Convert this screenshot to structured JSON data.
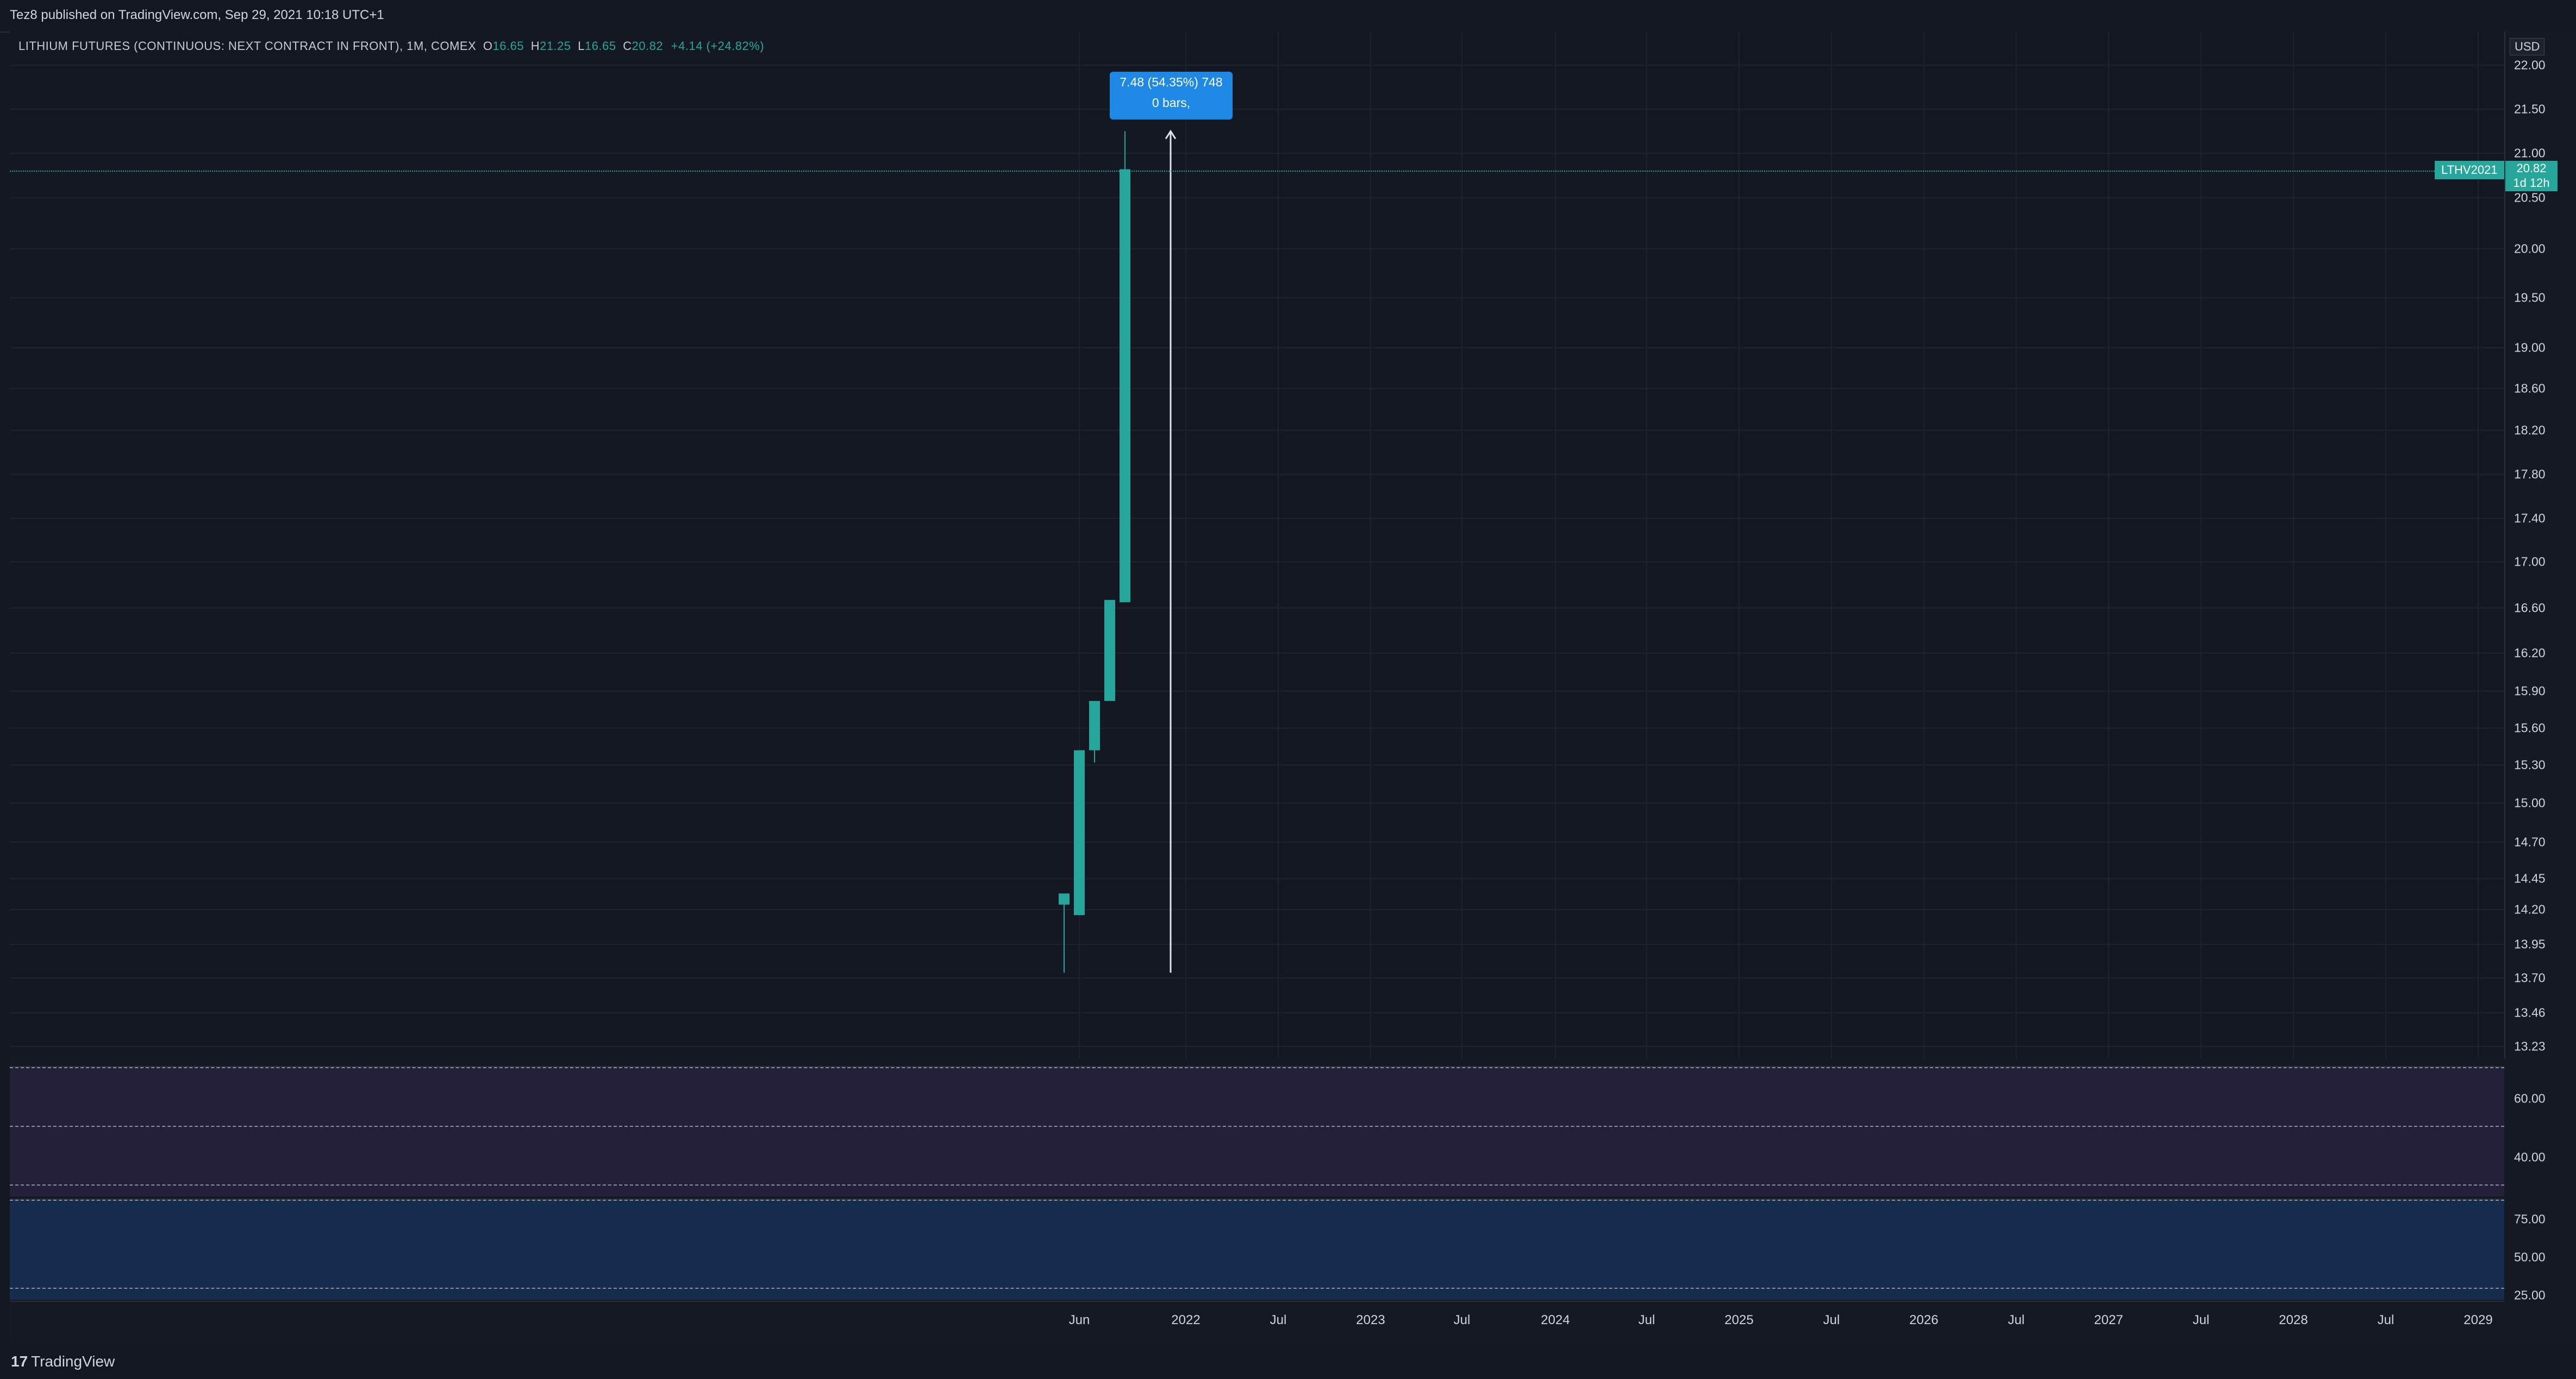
{
  "header": {
    "publisher_text": "Tez8 published on TradingView.com, Sep 29, 2021 10:18 UTC+1"
  },
  "legend": {
    "title": "LITHIUM FUTURES (CONTINUOUS: NEXT CONTRACT IN FRONT), 1M, COMEX",
    "o_label": "O",
    "o_value": "16.65",
    "h_label": "H",
    "h_value": "21.25",
    "l_label": "L",
    "l_value": "16.65",
    "c_label": "C",
    "c_value": "20.82",
    "change": "+4.14 (+24.82%)"
  },
  "price_axis": {
    "currency": "USD",
    "labels": [
      "22.00",
      "21.50",
      "21.00",
      "20.50",
      "20.00",
      "19.50",
      "19.00",
      "18.60",
      "18.20",
      "17.80",
      "17.40",
      "17.00",
      "16.60",
      "16.20",
      "15.90",
      "15.60",
      "15.30",
      "15.00",
      "14.70",
      "14.45",
      "14.20",
      "13.95",
      "13.70",
      "13.46",
      "13.23"
    ]
  },
  "price_marker": {
    "symbol": "LTHV2021",
    "price": "20.82",
    "countdown": "1d 12h"
  },
  "measure_tooltip": {
    "line1": "7.48 (54.35%) 748",
    "line2": "0 bars,"
  },
  "indicator1_axis": [
    "60.00",
    "40.00"
  ],
  "indicator2_axis": [
    "75.00",
    "50.00",
    "25.00"
  ],
  "time_axis": {
    "labels": [
      "Jun",
      "2022",
      "Jul",
      "2023",
      "Jul",
      "2024",
      "Jul",
      "2025",
      "Jul",
      "2026",
      "Jul",
      "2027",
      "Jul",
      "2028",
      "Jul",
      "2029"
    ]
  },
  "footer": {
    "brand_mark": "17",
    "brand_name": "TradingView"
  },
  "colors": {
    "up": "#26a69a",
    "background": "#131722",
    "tooltip": "#1e88e5"
  },
  "chart_data": {
    "type": "candlestick",
    "title": "LITHIUM FUTURES (CONTINUOUS: NEXT CONTRACT IN FRONT), 1M, COMEX",
    "candles": [
      {
        "open": 14.24,
        "high": 14.3,
        "low": 13.74,
        "close": 14.33
      },
      {
        "open": 14.16,
        "high": 15.42,
        "low": 14.16,
        "close": 15.42
      },
      {
        "open": 15.42,
        "high": 15.82,
        "low": 15.32,
        "close": 15.82
      },
      {
        "open": 15.82,
        "high": 16.67,
        "low": 15.82,
        "close": 16.67
      },
      {
        "open": 16.65,
        "high": 21.25,
        "low": 16.65,
        "close": 20.82
      }
    ],
    "measure": {
      "from": 13.74,
      "to": 21.25,
      "change": "7.48 (54.35%) 748"
    }
  }
}
